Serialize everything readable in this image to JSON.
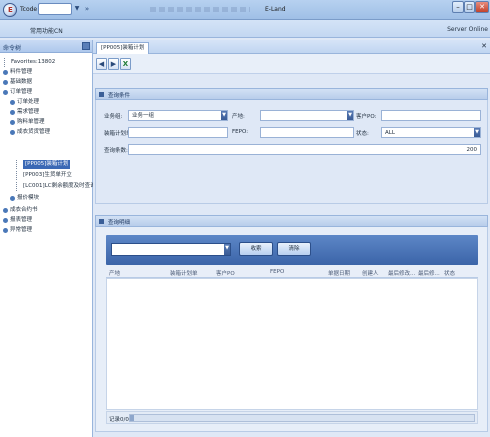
{
  "titlebar": {
    "tcode_label": "Tcode",
    "window_title": "E-Land",
    "logo_letter": "E",
    "dropdown_glyph": "▼",
    "go_glyph": "»",
    "minimize_glyph": "–",
    "maximize_glyph": "□",
    "close_glyph": "✕"
  },
  "menubar": {
    "common_functions": "常用功能CN",
    "server_status": "Server Online"
  },
  "sidebar": {
    "title": "命令树",
    "items": [
      {
        "label": "Favorites:13802"
      },
      {
        "label": "料件管理"
      },
      {
        "label": "基础数据"
      },
      {
        "label": "订单管理"
      },
      {
        "label": "订单处理"
      },
      {
        "label": "需求管理"
      },
      {
        "label": "购料单管理"
      },
      {
        "label": "成衣货货管理"
      },
      {
        "label": "[PP005]装箱计划"
      },
      {
        "label": "[PP003]生货单开立"
      },
      {
        "label": "[LC001]LC剩余额度及时查询"
      },
      {
        "label": "报价模块"
      },
      {
        "label": "成衣合约书"
      },
      {
        "label": "报表管理"
      },
      {
        "label": "异常管理"
      }
    ]
  },
  "tab": {
    "label": "[PP005]装箱计划",
    "close_glyph": "✕"
  },
  "toolbar": {
    "back_glyph": "◀",
    "forward_glyph": "▶",
    "excel_glyph": "X"
  },
  "query": {
    "title": "查询条件",
    "business_group_label": "业务组:",
    "business_group_value": "业务一组",
    "origin_label": "产地:",
    "origin_value": "",
    "customer_po_label": "客户PO:",
    "customer_po_value": "",
    "packing_plan_label": "装箱计划单:",
    "packing_plan_value": "",
    "fepo_label": "FEPO:",
    "fepo_value": "",
    "status_label": "状态:",
    "status_value": "ALL",
    "count_label": "查询条数:",
    "count_value": "200",
    "select_arrow": "▼"
  },
  "detail": {
    "title": "查询明细",
    "search_value": "",
    "search_button": "收索",
    "clear_button": "清除",
    "columns": [
      "产地",
      "装箱计划单",
      "客户PO",
      "FEPO",
      "单据日期",
      "创建人",
      "最后修改...",
      "最后修...",
      "状态"
    ],
    "record_count": "记录0/0"
  }
}
